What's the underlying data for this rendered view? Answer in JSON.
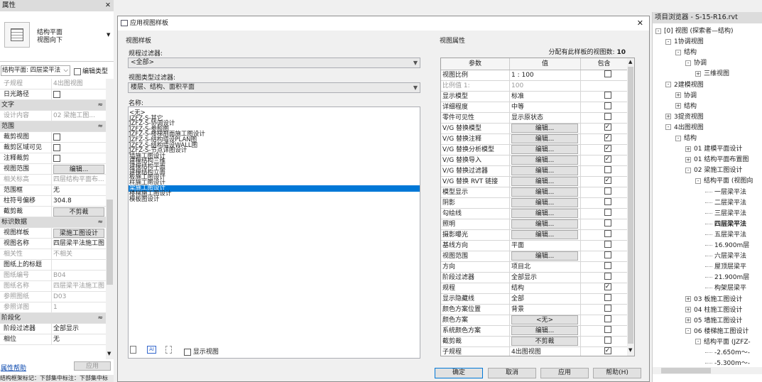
{
  "left": {
    "title": "属性",
    "type_line1": "结构平面",
    "type_line2": "视图向下",
    "view_select": "结构平面: 四层梁平法",
    "edit_type": "编辑类型",
    "help": "属性帮助",
    "apply": "应用",
    "status": "结构框架标记：下部集中标注：下部集中标",
    "rows": [
      {
        "k": "子规程",
        "v": "4出图视图",
        "g": true
      },
      {
        "k": "日光路径",
        "cb": false
      },
      {
        "sec": "文字"
      },
      {
        "k": "设计内容",
        "v": "02 梁施工图...",
        "g": true
      },
      {
        "sec": "范围"
      },
      {
        "k": "裁剪视图",
        "cb": false
      },
      {
        "k": "裁剪区域可见",
        "cb": false
      },
      {
        "k": "注释裁剪",
        "cb": false
      },
      {
        "k": "视图范围",
        "btn": "编辑..."
      },
      {
        "k": "相关标高",
        "v": "四层结构平面布...",
        "g": true
      },
      {
        "k": "范围框",
        "v": "无"
      },
      {
        "k": "柱符号偏移",
        "v": "304.8"
      },
      {
        "k": "截剪裁",
        "btn": "不剪裁"
      },
      {
        "sec": "标识数据"
      },
      {
        "k": "视图样板",
        "btn": "梁施工图设计"
      },
      {
        "k": "视图名称",
        "v": "四层梁平法施工图"
      },
      {
        "k": "相关性",
        "v": "不相关",
        "g": true
      },
      {
        "k": "图纸上的标题",
        "v": ""
      },
      {
        "k": "图纸编号",
        "v": "B04",
        "g": true
      },
      {
        "k": "图纸名称",
        "v": "四层梁平法施工图",
        "g": true
      },
      {
        "k": "参照图纸",
        "v": "D03",
        "g": true
      },
      {
        "k": "参照详图",
        "v": "1",
        "g": true
      },
      {
        "sec": "阶段化"
      },
      {
        "k": "阶段过滤器",
        "v": "全部显示"
      },
      {
        "k": "相位",
        "v": "无"
      }
    ]
  },
  "dialog": {
    "title": "应用视图样板",
    "close": "✕",
    "left_group": "视图样板",
    "discipline_label": "规程过滤器:",
    "discipline_value": "<全部>",
    "type_label": "视图类型过滤器:",
    "type_value": "楼层、结构、面积平面",
    "names_label": "名称:",
    "names": [
      "<无>",
      "JZFZ-S-其它",
      "JZFZ-S-协调设计",
      "JZFZ-S-参照图",
      "JZFZ-S-楼梯剖面施工图设计",
      "JZFZ-S-结构墙设PLAN图",
      "JZFZ-S-结构墙设WALL图",
      "JZFZ-S-节点详图设计",
      "墙施工图设计",
      "建模结构三维",
      "建模结构平面",
      "建模结构立面",
      "板施工图设计",
      "柱施工图设计",
      "梁施工图设计",
      "楼梯施工图设计",
      "模板图设计"
    ],
    "selected_index": 14,
    "show_views": "显示视图",
    "right_group": "视图属性",
    "assigned_label": "分配有此样板的视图数:",
    "assigned_count": "10",
    "col_param": "参数",
    "col_value": "值",
    "col_include": "包含",
    "props": [
      {
        "p": "视图比例",
        "v": "1 : 100",
        "c": false
      },
      {
        "p": "比例值 1:",
        "v": "100",
        "g": true
      },
      {
        "p": "显示模型",
        "v": "标准",
        "c": false
      },
      {
        "p": "详细程度",
        "v": "中等",
        "c": false
      },
      {
        "p": "零件可见性",
        "v": "显示原状态",
        "c": false
      },
      {
        "p": "V/G 替换模型",
        "b": "编辑...",
        "c": true
      },
      {
        "p": "V/G 替换注释",
        "b": "编辑...",
        "c": true
      },
      {
        "p": "V/G 替换分析模型",
        "b": "编辑...",
        "c": true
      },
      {
        "p": "V/G 替换导入",
        "b": "编辑...",
        "c": true
      },
      {
        "p": "V/G 替换过滤器",
        "b": "编辑...",
        "c": false
      },
      {
        "p": "V/G 替换 RVT 链接",
        "b": "编辑...",
        "c": true
      },
      {
        "p": "模型显示",
        "b": "编辑...",
        "c": false
      },
      {
        "p": "阴影",
        "b": "编辑...",
        "c": false
      },
      {
        "p": "勾绘线",
        "b": "编辑...",
        "c": false
      },
      {
        "p": "照明",
        "b": "编辑...",
        "c": false
      },
      {
        "p": "摄影曝光",
        "b": "编辑...",
        "c": false
      },
      {
        "p": "基线方向",
        "v": "平面",
        "c": false
      },
      {
        "p": "视图范围",
        "b": "编辑...",
        "c": false
      },
      {
        "p": "方向",
        "v": "项目北",
        "c": false
      },
      {
        "p": "阶段过滤器",
        "v": "全部显示",
        "c": false
      },
      {
        "p": "规程",
        "v": "结构",
        "c": true
      },
      {
        "p": "显示隐藏线",
        "v": "全部",
        "c": false
      },
      {
        "p": "颜色方案位置",
        "v": "背景",
        "c": false
      },
      {
        "p": "颜色方案",
        "b": "<无>",
        "c": false
      },
      {
        "p": "系统颜色方案",
        "b": "编辑...",
        "c": false
      },
      {
        "p": "截剪裁",
        "b": "不剪裁",
        "c": false
      },
      {
        "p": "子规程",
        "v": "4出图视图",
        "c": true
      }
    ],
    "ok": "确定",
    "cancel": "取消",
    "apply": "应用",
    "help": "帮助(H)"
  },
  "browser": {
    "title": "项目浏览器 - S-15-R16.rvt",
    "items": [
      {
        "d": 0,
        "t": "[0] 视图 (探索者—结构)",
        "x": "−"
      },
      {
        "d": 1,
        "t": "1协调视图",
        "x": "−"
      },
      {
        "d": 2,
        "t": "结构",
        "x": "−"
      },
      {
        "d": 3,
        "t": "协调",
        "x": "−"
      },
      {
        "d": 4,
        "t": "三维视图",
        "x": "+"
      },
      {
        "d": 1,
        "t": "2建模视图",
        "x": "−"
      },
      {
        "d": 2,
        "t": "协调",
        "x": "+"
      },
      {
        "d": 2,
        "t": "结构",
        "x": "+"
      },
      {
        "d": 1,
        "t": "3提资视图",
        "x": "+"
      },
      {
        "d": 1,
        "t": "4出图视图",
        "x": "−"
      },
      {
        "d": 2,
        "t": "结构",
        "x": "−"
      },
      {
        "d": 3,
        "t": "01 建模平面设计",
        "x": "+"
      },
      {
        "d": 3,
        "t": "01 结构平面布置图",
        "x": "+"
      },
      {
        "d": 3,
        "t": "02 梁施工图设计",
        "x": "−"
      },
      {
        "d": 4,
        "t": "结构平面 (视图向",
        "x": "−"
      },
      {
        "d": 5,
        "t": "一层梁平法",
        "x": ""
      },
      {
        "d": 5,
        "t": "二层梁平法",
        "x": ""
      },
      {
        "d": 5,
        "t": "三层梁平法",
        "x": ""
      },
      {
        "d": 5,
        "t": "四层梁平法",
        "x": "",
        "b": true
      },
      {
        "d": 5,
        "t": "五层梁平法",
        "x": ""
      },
      {
        "d": 5,
        "t": "16.900m层",
        "x": ""
      },
      {
        "d": 5,
        "t": "六层梁平法",
        "x": ""
      },
      {
        "d": 5,
        "t": "屋顶层梁平",
        "x": ""
      },
      {
        "d": 5,
        "t": "21.900m层",
        "x": ""
      },
      {
        "d": 5,
        "t": "构架层梁平",
        "x": ""
      },
      {
        "d": 3,
        "t": "03 板施工图设计",
        "x": "+"
      },
      {
        "d": 3,
        "t": "04 柱施工图设计",
        "x": "+"
      },
      {
        "d": 3,
        "t": "05 墙施工图设计",
        "x": "+"
      },
      {
        "d": 3,
        "t": "06 楼梯施工图设计",
        "x": "−"
      },
      {
        "d": 4,
        "t": "结构平面 (JZFZ-",
        "x": "−"
      },
      {
        "d": 5,
        "t": "-2.650m～-",
        "x": ""
      },
      {
        "d": 5,
        "t": "-5.300m～-",
        "x": ""
      }
    ]
  }
}
